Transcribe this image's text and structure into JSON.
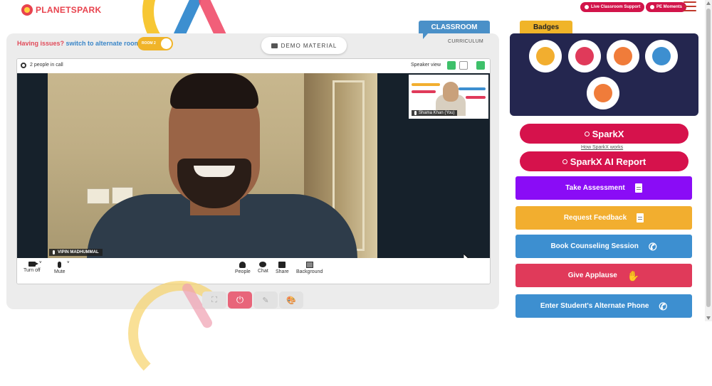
{
  "header": {
    "logo_text": "PLANETSPARK",
    "live_support_label": "Live Classroom Support",
    "pe_moments_label": "PE Moments"
  },
  "classroom": {
    "tab_label": "CLASSROOM",
    "curriculum_label": "CURRICULUM",
    "issues_prefix": "Having issues?",
    "issues_link": "switch to alternate room",
    "room_toggle_label": "ROOM 2",
    "demo_material_label": "DEMO MATERIAL"
  },
  "call": {
    "people_count": "2 people in call",
    "speaker_view_label": "Speaker view",
    "main_participant": "VIPIN MADHUMMAL",
    "self_participant": "Shama Khan (You)",
    "controls": {
      "turn_off": "Turn off",
      "mute": "Mute",
      "people": "People",
      "chat": "Chat",
      "share": "Share",
      "background": "Background"
    }
  },
  "sidebar": {
    "badges_label": "Badges",
    "sparkx_label": "SparkX",
    "how_sparkx_works": "How SparkX works",
    "sparkx_report_label": "SparkX AI Report",
    "buttons": [
      {
        "label": "Take Assessment",
        "icon": "clipboard-icon",
        "color": "#8a0cf6"
      },
      {
        "label": "Request Feedback",
        "icon": "document-icon",
        "color": "#f2ae2f"
      },
      {
        "label": "Book Counseling Session",
        "icon": "phone-icon",
        "color": "#3d8fd0"
      },
      {
        "label": "Give Applause",
        "icon": "applause-icon",
        "color": "#e03a5a"
      },
      {
        "label": "Enter Student's Alternate Phone",
        "icon": "phone-icon",
        "color": "#3d8fd0"
      }
    ]
  },
  "colors": {
    "brand_red": "#d6124c",
    "badges_panel": "#24264f",
    "classroom_tab": "#4a90c8",
    "badges_tab": "#f0b429"
  }
}
